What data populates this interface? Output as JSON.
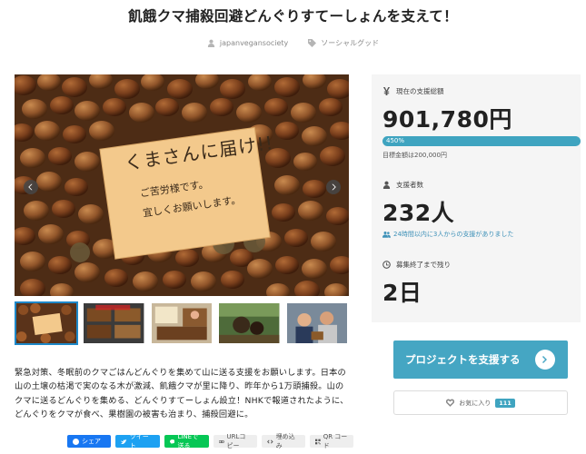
{
  "page": {
    "title": "飢餓クマ捕殺回避どんぐりすてーしょんを支えて！",
    "author": "japanvegansociety",
    "category": "ソーシャルグッド"
  },
  "stats": {
    "amount_label": "現在の支援総額",
    "amount": "901,780円",
    "progress_text": "450%",
    "progress_percent": 100,
    "goal": "目標金額は200,000円",
    "supporters_label": "支援者数",
    "supporters": "232人",
    "recent": "24時間以内に3人からの支援がありました",
    "deadline_label": "募集終了まで残り",
    "days_left": "2日"
  },
  "photo": {
    "sign_line1": "くまさんに届け!!",
    "sign_line2": "ご苦労様です。",
    "sign_line3": "宜しくお願いします。"
  },
  "description": "緊急対策、冬眠前のクマごはんどんぐりを集めて山に送る支援をお願いします。日本の山の土壌の枯渇で実のなる木が激減、飢餓クマが里に降り、昨年から1万頭捕殺。山のクマに送るどんぐりを集める、どんぐりすてーしょん設立！NHKで報道されたように、どんぐりをクマが食べ、果樹園の被害も治まり、捕殺回避に。",
  "actions": {
    "support": "プロジェクトを支援する",
    "favorite": "お気に入り",
    "favorite_count": "111"
  },
  "share": {
    "facebook": "シェア",
    "twitter": "ツイート",
    "line": "LINEで送る",
    "url": "URLコピー",
    "embed": "埋め込み",
    "qr": "QR コード"
  },
  "colors": {
    "accent": "#45a6c3",
    "progress": "#3fa4c0",
    "panel": "#f5f5f5"
  }
}
